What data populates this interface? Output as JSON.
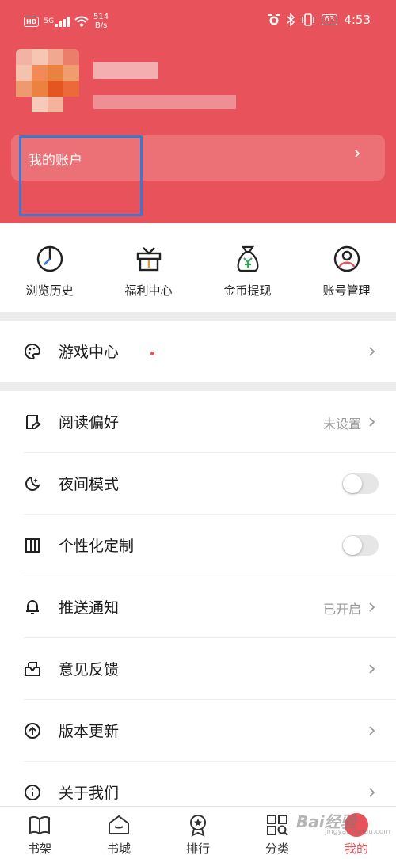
{
  "status_bar": {
    "hd": "HD",
    "network": "5G",
    "speed_value": "514",
    "speed_unit": "B/s",
    "battery": "63",
    "time": "4:53"
  },
  "account": {
    "label": "我的账户"
  },
  "quick_actions": [
    {
      "label": "浏览历史",
      "icon": "history-icon"
    },
    {
      "label": "福利中心",
      "icon": "gift-icon"
    },
    {
      "label": "金币提现",
      "icon": "coin-bag-icon"
    },
    {
      "label": "账号管理",
      "icon": "account-icon"
    }
  ],
  "game": {
    "label": "游戏中心"
  },
  "settings": [
    {
      "label": "阅读偏好",
      "value": "未设置",
      "icon": "reading-icon"
    },
    {
      "label": "夜间模式",
      "toggle": false,
      "icon": "moon-icon"
    },
    {
      "label": "个性化定制",
      "toggle": false,
      "icon": "customize-icon"
    },
    {
      "label": "推送通知",
      "value": "已开启",
      "icon": "bell-icon"
    },
    {
      "label": "意见反馈",
      "icon": "feedback-icon"
    },
    {
      "label": "版本更新",
      "icon": "update-icon"
    },
    {
      "label": "关于我们",
      "icon": "info-icon"
    }
  ],
  "tabs": [
    {
      "label": "书架",
      "icon": "bookshelf-icon"
    },
    {
      "label": "书城",
      "icon": "bookstore-icon"
    },
    {
      "label": "排行",
      "icon": "ranking-icon"
    },
    {
      "label": "分类",
      "icon": "category-icon"
    },
    {
      "label": "我的",
      "icon": "profile-icon",
      "active": true
    }
  ],
  "watermark": {
    "main": "Bai经验",
    "sub": "jingyan.baidu.com"
  },
  "colors": {
    "accent": "#e8525a",
    "highlight": "#3a78d6"
  }
}
